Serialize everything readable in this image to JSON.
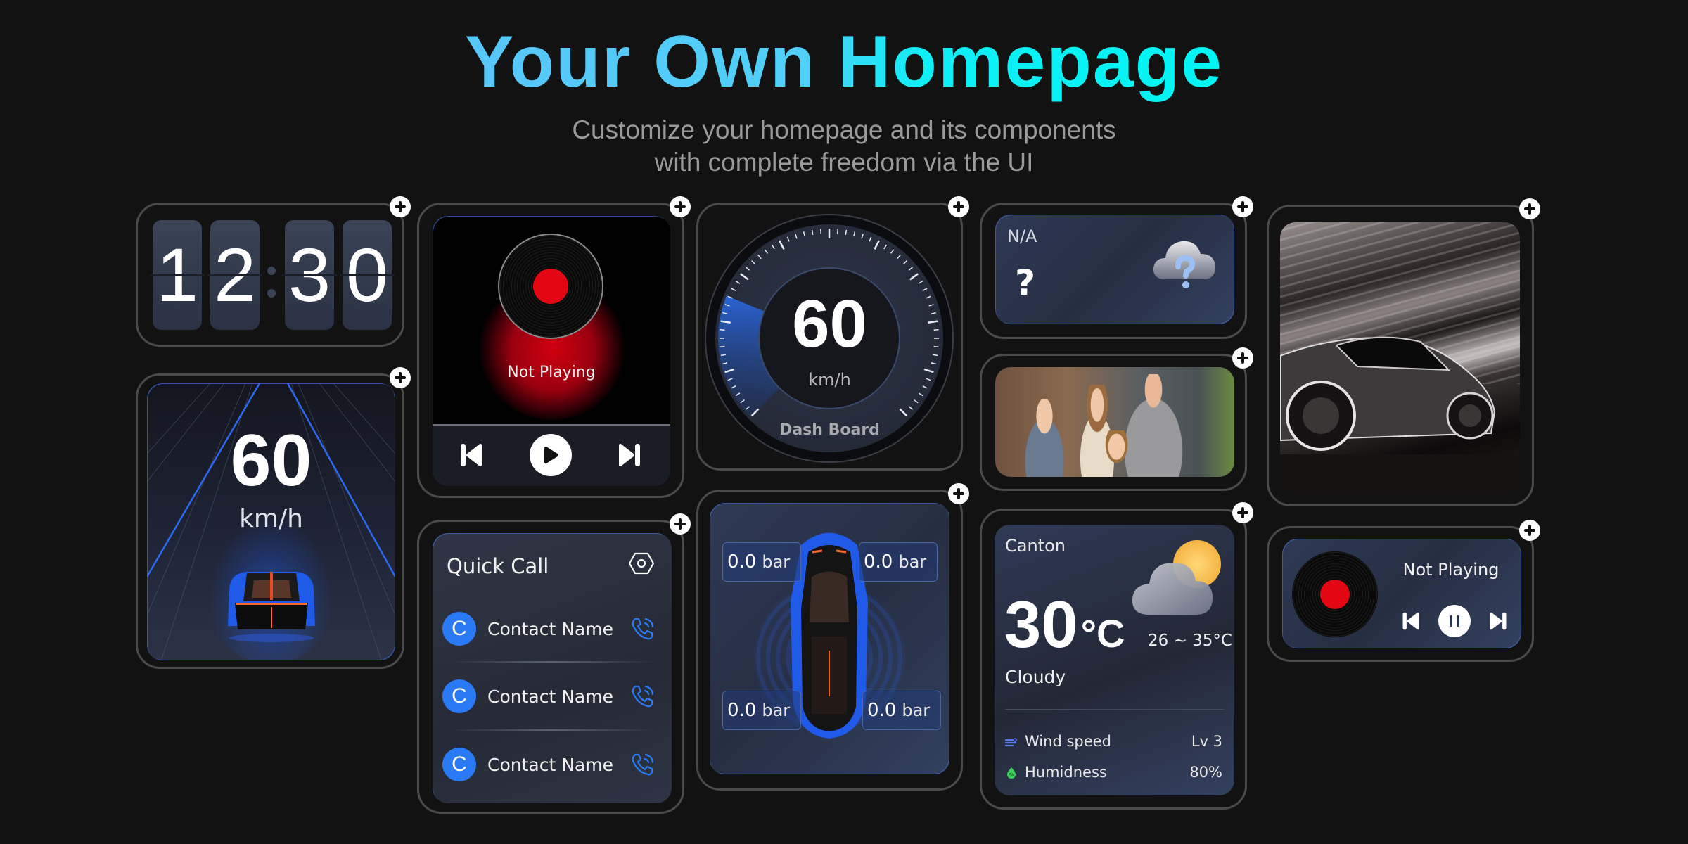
{
  "header": {
    "title": "Your Own Homepage",
    "subtitle_line1": "Customize your homepage and its components",
    "subtitle_line2": "with complete freedom via the UI"
  },
  "add_widget_icon": "plus-icon",
  "clock": {
    "digits": [
      "1",
      "2",
      "3",
      "0"
    ],
    "time": "12:30"
  },
  "music_player": {
    "status": "Not Playing",
    "controls": [
      "previous",
      "play",
      "next"
    ]
  },
  "dashboard": {
    "speed": "60",
    "unit": "km/h",
    "label": "Dash Board",
    "speed_fraction": 0.25
  },
  "weather_unavailable": {
    "location": "N/A",
    "temperature": "?",
    "icon": "cloud-question-icon"
  },
  "photo_widget": {
    "description": "Family photo"
  },
  "speed_widget": {
    "speed": "60",
    "unit": "km/h"
  },
  "quick_call": {
    "title": "Quick Call",
    "settings_icon": "hexagon-settings-icon",
    "contacts": [
      {
        "initial": "C",
        "name": "Contact Name"
      },
      {
        "initial": "C",
        "name": "Contact Name"
      },
      {
        "initial": "C",
        "name": "Contact Name"
      }
    ]
  },
  "tire_pressure": {
    "front_left": "0.0",
    "front_right": "0.0",
    "rear_left": "0.0",
    "rear_right": "0.0",
    "unit": "bar"
  },
  "weather": {
    "city": "Canton",
    "temperature": "30",
    "temp_unit": "°C",
    "range": "26 ~ 35°C",
    "condition": "Cloudy",
    "wind_label": "Wind speed",
    "wind_value": "Lv 3",
    "humidity_label": "Humidness",
    "humidity_value": "80%"
  },
  "car_wallpaper": {
    "description": "Silver sports car with light trails"
  },
  "mini_player": {
    "status": "Not Playing",
    "controls": [
      "previous",
      "pause",
      "next"
    ]
  },
  "colors": {
    "accent_blue": "#2a7af5",
    "vinyl_red": "#e30613",
    "title_start": "#58c6fa",
    "title_end": "#00f6f4"
  }
}
